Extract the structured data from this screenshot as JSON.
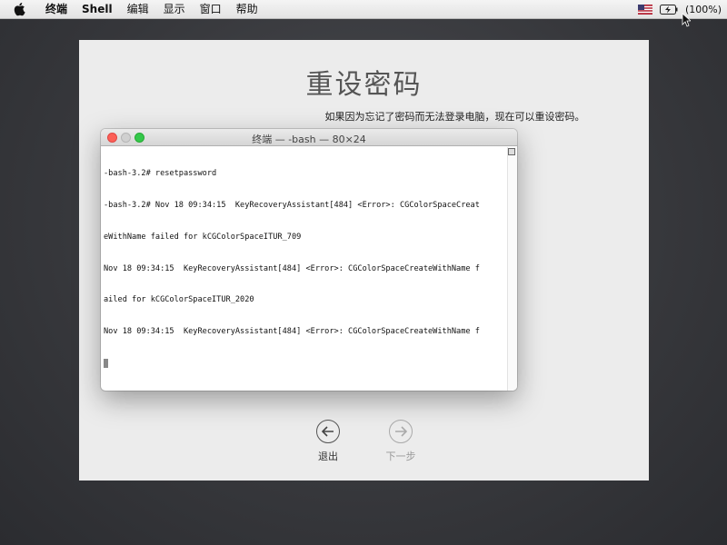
{
  "menubar": {
    "app_name": "终端",
    "items": [
      "Shell",
      "编辑",
      "显示",
      "窗口",
      "帮助"
    ],
    "battery": "(100%)"
  },
  "panel": {
    "title": "重设密码",
    "subtitle": "如果因为忘记了密码而无法登录电脑，现在可以重设密码。",
    "back_label": "退出",
    "next_label": "下一步"
  },
  "terminal": {
    "title": "终端 — -bash — 80×24",
    "lines": [
      "-bash-3.2# resetpassword",
      "-bash-3.2# Nov 18 09:34:15  KeyRecoveryAssistant[484] <Error>: CGColorSpaceCreat",
      "eWithName failed for kCGColorSpaceITUR_709",
      "Nov 18 09:34:15  KeyRecoveryAssistant[484] <Error>: CGColorSpaceCreateWithName f",
      "ailed for kCGColorSpaceITUR_2020",
      "Nov 18 09:34:15  KeyRecoveryAssistant[484] <Error>: CGColorSpaceCreateWithName f"
    ]
  },
  "colors": {
    "close": "#fc5f57",
    "maximize": "#34c84a",
    "desktop": "#36373b"
  }
}
